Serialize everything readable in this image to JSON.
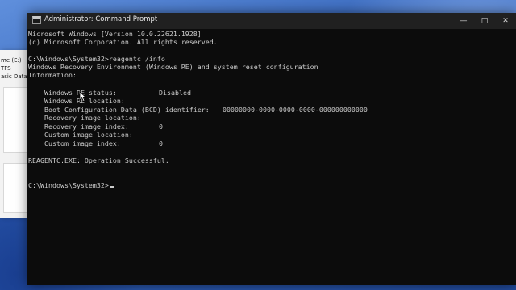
{
  "background_window": {
    "lines": [
      "me (E:)",
      "TFS",
      "asic Data"
    ]
  },
  "window": {
    "title": "Administrator: Command Prompt",
    "icon": "cmd-icon",
    "controls": {
      "minimize": "—",
      "maximize": "□",
      "close": "✕"
    }
  },
  "console": {
    "header": {
      "version": "Microsoft Windows [Version 10.0.22621.1928]",
      "copyright": "(c) Microsoft Corporation. All rights reserved."
    },
    "command_line": "C:\\Windows\\System32>reagentc /info",
    "info_header_1": "Windows Recovery Environment (Windows RE) and system reset configuration",
    "info_header_2": "Information:",
    "entries": [
      {
        "label": "Windows RE status:",
        "value": "Disabled"
      },
      {
        "label": "Windows RE location:",
        "value": ""
      },
      {
        "label": "Boot Configuration Data (BCD) identifier:",
        "value": "00000000-0000-0000-0000-000000000000"
      },
      {
        "label": "Recovery image location:",
        "value": ""
      },
      {
        "label": "Recovery image index:",
        "value": "0"
      },
      {
        "label": "Custom image location:",
        "value": ""
      },
      {
        "label": "Custom image index:",
        "value": "0"
      }
    ],
    "result": "REAGENTC.EXE: Operation Successful.",
    "prompt": "C:\\Windows\\System32>"
  },
  "colors": {
    "console_bg": "#0c0c0c",
    "console_text": "#cccccc",
    "titlebar_bg": "#202020",
    "desktop_accent": "#3a67b6"
  }
}
